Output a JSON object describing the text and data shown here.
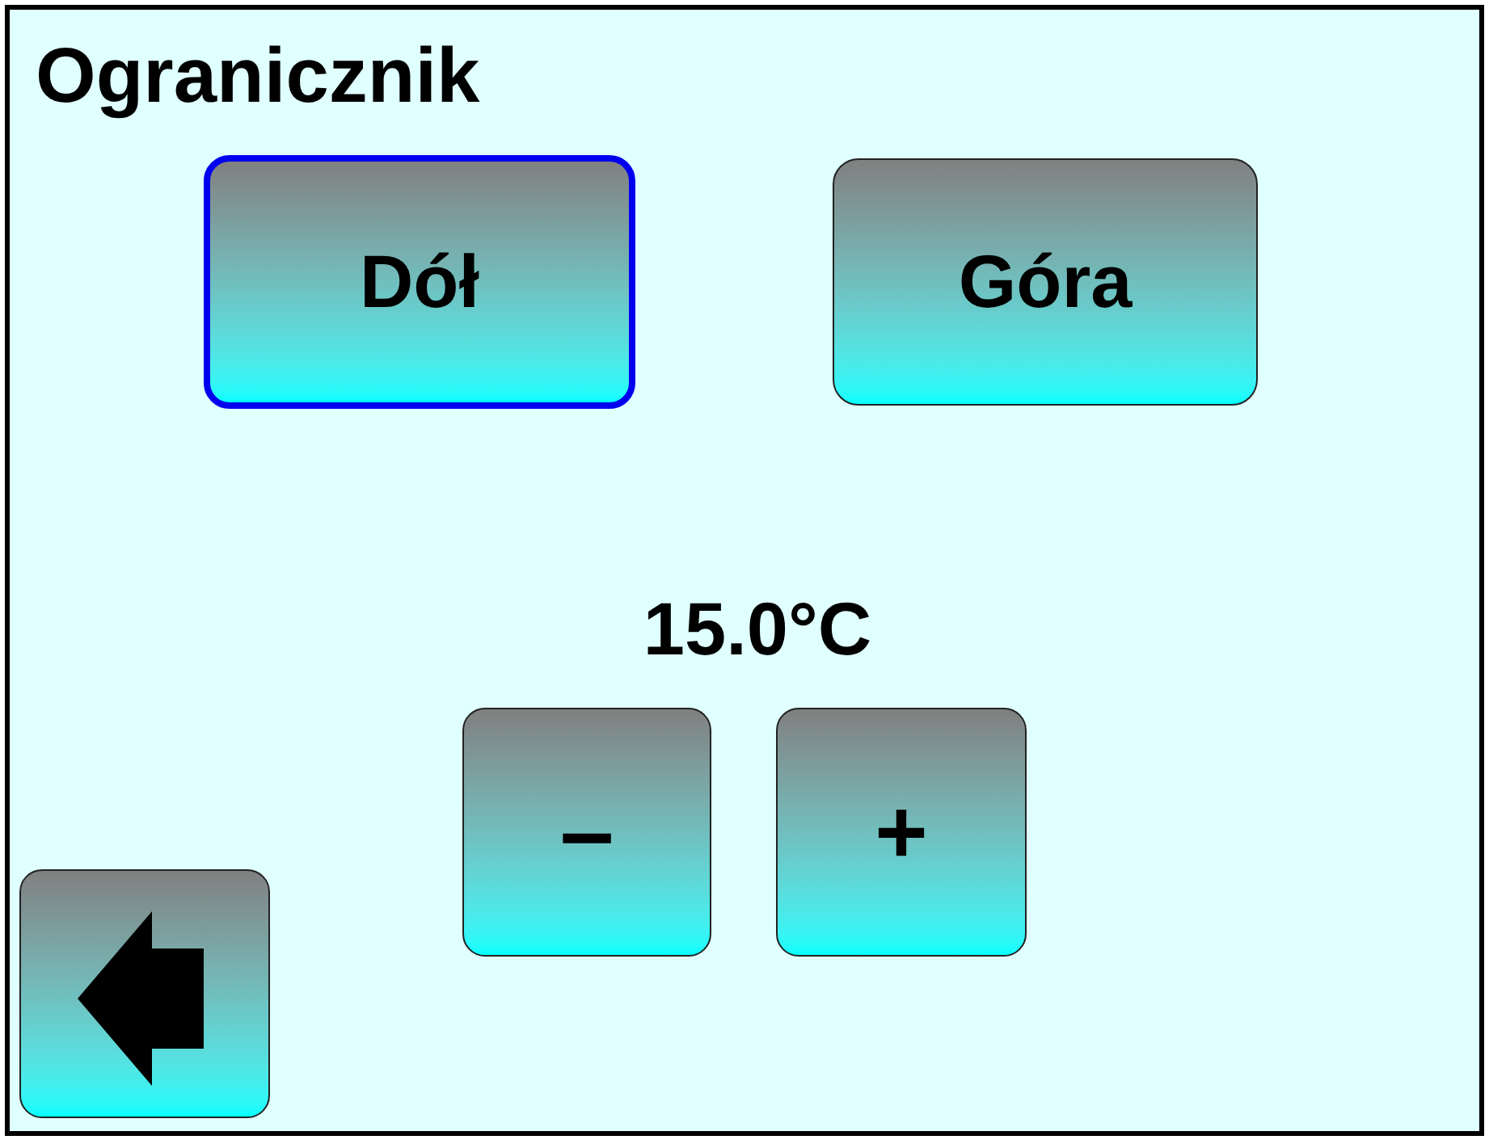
{
  "title": "Ogranicznik",
  "modes": [
    {
      "label": "Dół",
      "selected": true
    },
    {
      "label": "Góra",
      "selected": false
    }
  ],
  "setpoint": {
    "value": "15.0°C",
    "decrease": "–",
    "increase": "+"
  }
}
